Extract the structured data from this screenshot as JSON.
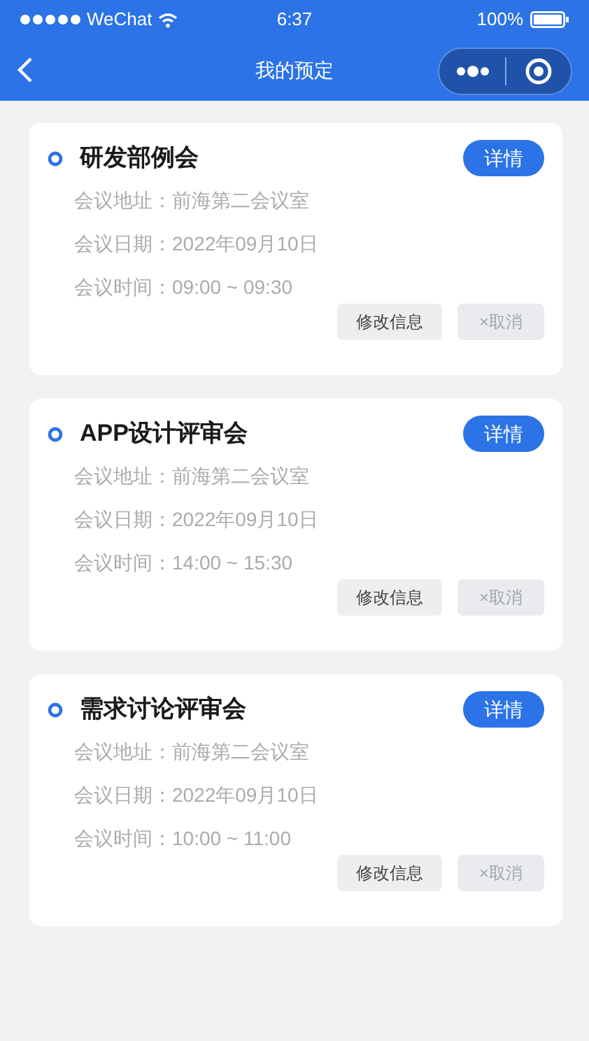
{
  "status_bar": {
    "carrier": "WeChat",
    "time": "6:37",
    "battery": "100%"
  },
  "nav": {
    "title": "我的预定"
  },
  "meetings": [
    {
      "title": "研发部例会",
      "detail_button": "详情",
      "lines": [
        "会议地址：前海第二会议室",
        "会议日期：2022年09月10日",
        "会议时间：09:00 ~ 09:30"
      ],
      "edit_button": "修改信息",
      "cancel_button": "×取消"
    },
    {
      "title": "APP设计评审会",
      "detail_button": "详情",
      "lines": [
        "会议地址：前海第二会议室",
        "会议日期：2022年09月10日",
        "会议时间：14:00 ~ 15:30"
      ],
      "edit_button": "修改信息",
      "cancel_button": "×取消"
    },
    {
      "title": "需求讨论评审会",
      "detail_button": "详情",
      "lines": [
        "会议地址：前海第二会议室",
        "会议日期：2022年09月10日",
        "会议时间：10:00 ~ 11:00"
      ],
      "edit_button": "修改信息",
      "cancel_button": "×取消"
    }
  ]
}
